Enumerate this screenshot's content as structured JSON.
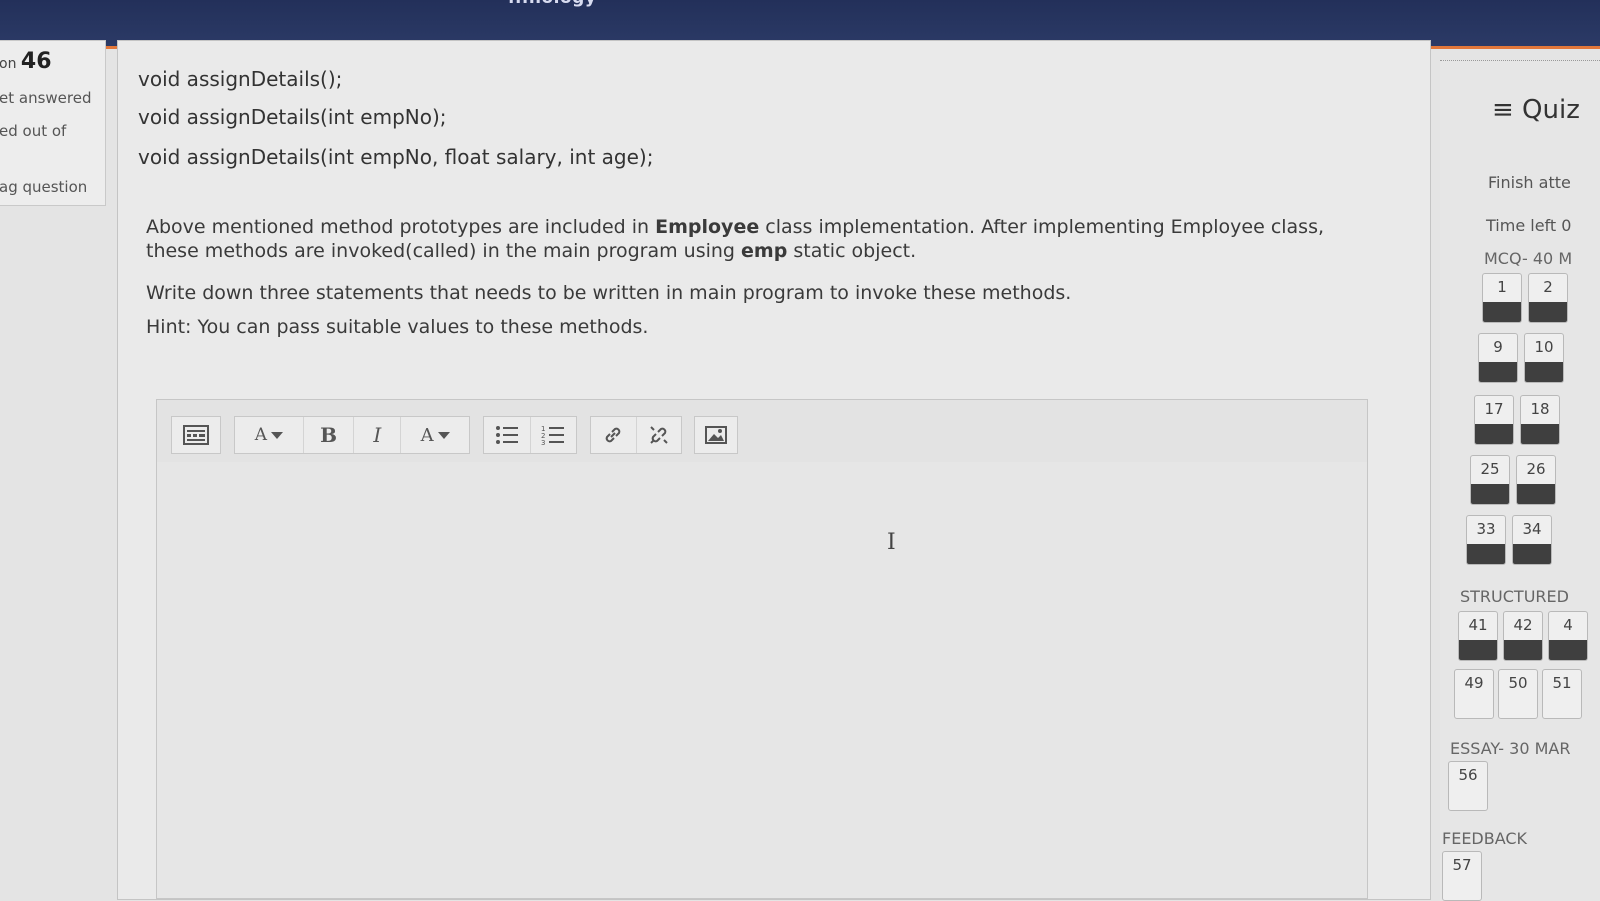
{
  "header": {
    "site_title": "...nology"
  },
  "question_info": {
    "qno_prefix": "on",
    "qno": "46",
    "status": "et answered",
    "marked": "ed out of",
    "flag": "ag question"
  },
  "question": {
    "code_lines": [
      "void assignDetails();",
      "void assignDetails(int empNo);",
      "void assignDetails(int empNo, float salary, int age);"
    ],
    "para1_a": "Above mentioned method prototypes are included in ",
    "para1_b": "Employee",
    "para1_c": " class implementation. After implementing Employee class, these methods are invoked(called) in the main program using ",
    "para1_d": "emp",
    "para1_e": " static object.",
    "para2": "Write down three statements that needs to be written in main program to invoke these methods.",
    "para3": "Hint: You can pass suitable values to these methods."
  },
  "editor": {
    "toolbar": {
      "font_size": "A",
      "bold": "B",
      "italic": "I",
      "font_color": "A"
    },
    "content": ""
  },
  "quiz_nav": {
    "title": "≡ Quiz",
    "finish": "Finish atte",
    "time_left": "Time left 0",
    "sections": [
      {
        "label": "MCQ- 40 M"
      },
      {
        "label": "STRUCTURED"
      },
      {
        "label": "ESSAY- 30 MAR"
      },
      {
        "label": "FEEDBACK"
      }
    ],
    "buttons": [
      "1",
      "2",
      "9",
      "10",
      "17",
      "18",
      "25",
      "26",
      "33",
      "34",
      "41",
      "42",
      "4",
      "49",
      "50",
      "51",
      "56",
      "57"
    ]
  }
}
